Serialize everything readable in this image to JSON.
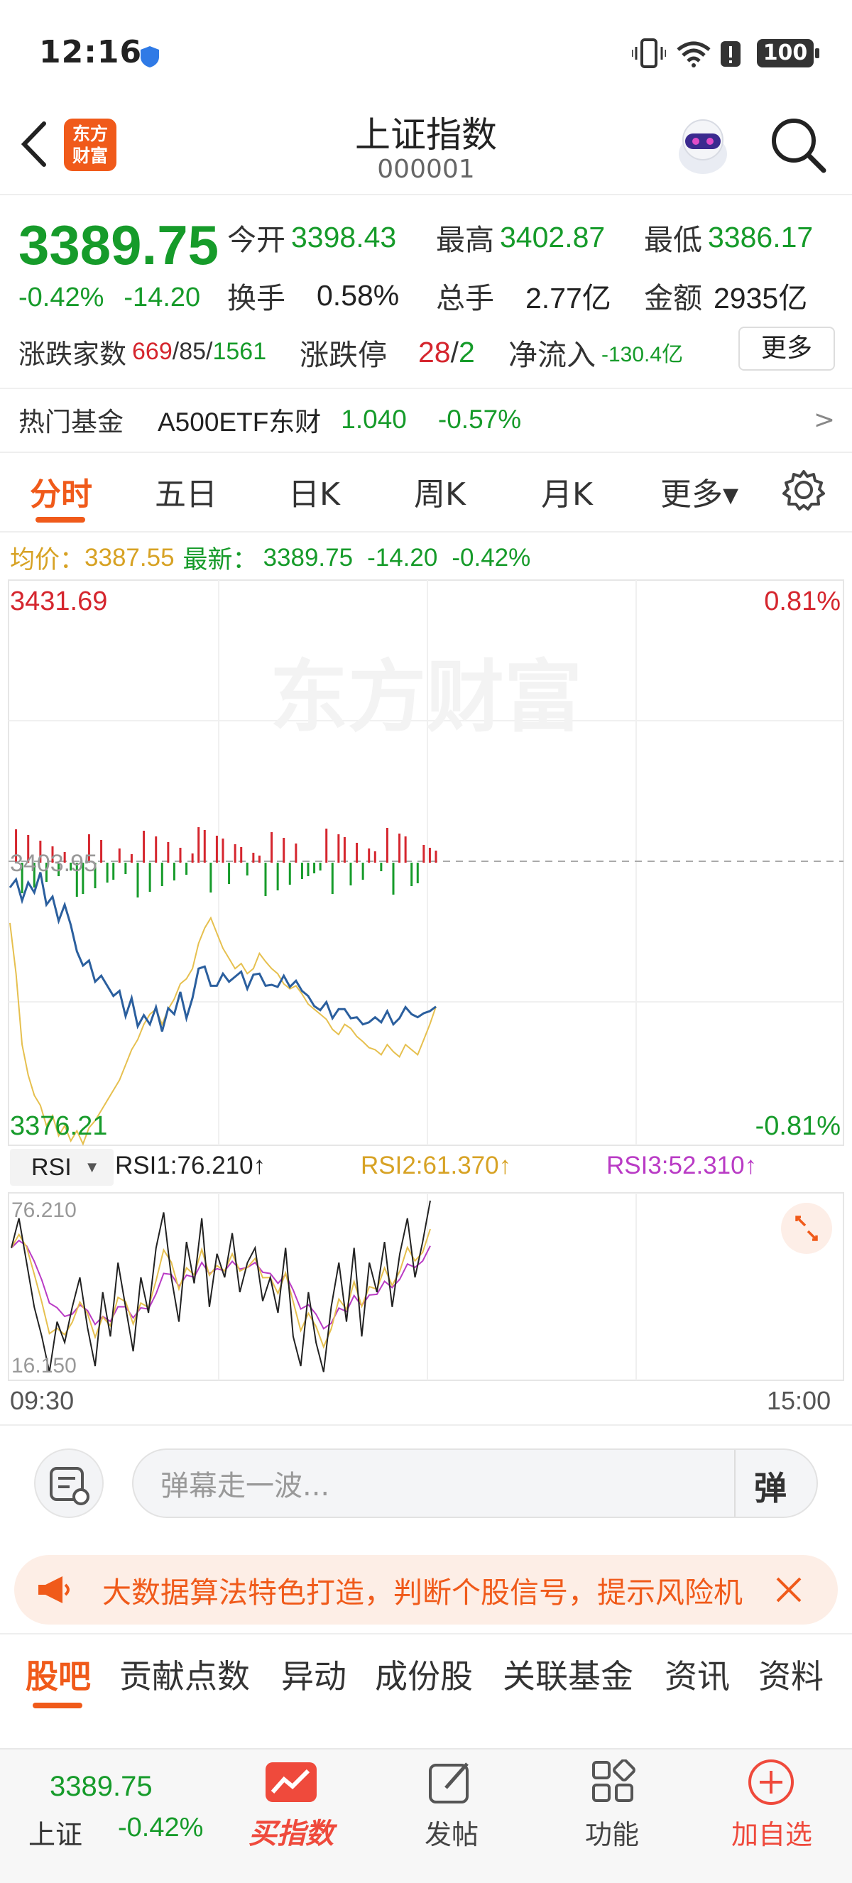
{
  "status": {
    "time": "12:16",
    "battery": "100"
  },
  "header": {
    "title": "上证指数",
    "code": "000001",
    "logo_line1": "东方",
    "logo_line2": "财富"
  },
  "quote": {
    "price": "3389.75",
    "change_pct": "-0.42%",
    "change": "-14.20",
    "open_label": "今开",
    "open": "3398.43",
    "high_label": "最高",
    "high": "3402.87",
    "low_label": "最低",
    "low": "3386.17",
    "turnover_label": "换手",
    "turnover": "0.58%",
    "volume_label": "总手",
    "volume": "2.77亿",
    "amount_label": "金额",
    "amount": "2935亿",
    "breadth_label": "涨跌家数",
    "breadth_up": "669",
    "breadth_flat": "85",
    "breadth_down": "1561",
    "limit_label": "涨跌停",
    "limit_up": "28",
    "limit_down": "2",
    "netflow_label": "净流入",
    "netflow": "-130.4亿",
    "more_button": "更多"
  },
  "hot_fund": {
    "label": "热门基金",
    "name": "A500ETF东财",
    "price": "1.040",
    "change": "-0.57%",
    "arrow": ">"
  },
  "tabs": [
    "分时",
    "五日",
    "日K",
    "周K",
    "月K",
    "更多▾"
  ],
  "info_line": {
    "avg_label": "均价：",
    "avg": "3387.55",
    "latest_label": "最新：",
    "latest": "3389.75",
    "change": "-14.20",
    "pct": "-0.42%"
  },
  "chart": {
    "max_label": "3431.69",
    "min_label": "3376.21",
    "max_pct": "0.81%",
    "min_pct": "-0.81%",
    "prev_close_label": "3403.95",
    "watermark": "东方财富",
    "start_time": "09:30",
    "end_time": "15:00"
  },
  "chart_data": {
    "type": "line",
    "x_range": [
      "09:30",
      "15:00"
    ],
    "ylim": [
      3376.21,
      3431.69
    ],
    "prev_close": 3403.95,
    "series": [
      {
        "name": "最新",
        "color": "#2b5f9e",
        "values": [
          3401.5,
          3402.3,
          3400.2,
          3402.0,
          3401.0,
          3403.0,
          3399.8,
          3400.6,
          3398.2,
          3399.8,
          3397.8,
          3395.2,
          3393.8,
          3394.3,
          3392.2,
          3392.8,
          3391.8,
          3390.8,
          3391.3,
          3388.8,
          3390.6,
          3387.8,
          3388.9,
          3388.0,
          3389.7,
          3387.3,
          3389.6,
          3389.0,
          3391.2,
          3388.6,
          3390.6,
          3393.5,
          3393.7,
          3391.8,
          3391.8,
          3393.0,
          3392.2,
          3392.7,
          3393.2,
          3391.5,
          3392.9,
          3393.0,
          3391.8,
          3391.9,
          3391.7,
          3392.8,
          3391.7,
          3392.3,
          3391.3,
          3390.8,
          3389.8,
          3389.4,
          3390.2,
          3388.6,
          3389.5,
          3389.5,
          3388.6,
          3388.7,
          3388.0,
          3388.2,
          3388.7,
          3388.2,
          3389.3,
          3388.0,
          3388.6,
          3389.7,
          3389.0,
          3388.7,
          3389.1,
          3389.3,
          3389.75
        ]
      },
      {
        "name": "均价",
        "color": "#e6c04f",
        "values": [
          3398.0,
          3393.0,
          3386.0,
          3383.0,
          3381.0,
          3380.0,
          3378.0,
          3379.0,
          3377.0,
          3378.0,
          3376.5,
          3377.5,
          3376.2,
          3377.8,
          3378.5,
          3379.5,
          3380.5,
          3381.5,
          3382.5,
          3384.0,
          3385.5,
          3386.5,
          3388.0,
          3389.0,
          3389.5,
          3388.0,
          3389.5,
          3390.5,
          3392.0,
          3392.5,
          3393.5,
          3396.0,
          3397.5,
          3398.5,
          3397.0,
          3395.5,
          3394.5,
          3393.5,
          3394.0,
          3393.0,
          3393.5,
          3395.0,
          3394.2,
          3393.5,
          3393.0,
          3392.0,
          3391.5,
          3391.8,
          3391.0,
          3390.0,
          3389.5,
          3389.0,
          3388.5,
          3387.5,
          3387.0,
          3388.0,
          3387.6,
          3386.8,
          3386.3,
          3385.7,
          3385.5,
          3385.0,
          3386.0,
          3385.3,
          3384.8,
          3386.0,
          3385.5,
          3385.0,
          3386.5,
          3388.0,
          3389.75
        ]
      }
    ]
  },
  "rsi": {
    "selector": "RSI",
    "rsi1": "RSI1:76.210↑",
    "rsi2": "RSI2:61.370↑",
    "rsi3": "RSI3:52.310↑",
    "max_label": "76.210",
    "min_label": "16.150"
  },
  "danmu": {
    "placeholder": "弹幕走一波...",
    "send_label": "弹"
  },
  "banner": {
    "text": "大数据算法特色打造，判断个股信号，提示风险机"
  },
  "section_tabs": [
    "股吧",
    "贡献点数",
    "异动",
    "成份股",
    "关联基金",
    "资讯",
    "资料"
  ],
  "bottom_bar": {
    "price": "3389.75",
    "name": "上证",
    "pct": "-0.42%",
    "buy_label": "买指数",
    "post_label": "发帖",
    "func_label": "功能",
    "add_label": "加自选"
  },
  "colors": {
    "up": "#d5262e",
    "down": "#169b2a",
    "accent": "#f05a1a",
    "price_line": "#2b5f9e",
    "avg_line": "#e6c04f"
  }
}
